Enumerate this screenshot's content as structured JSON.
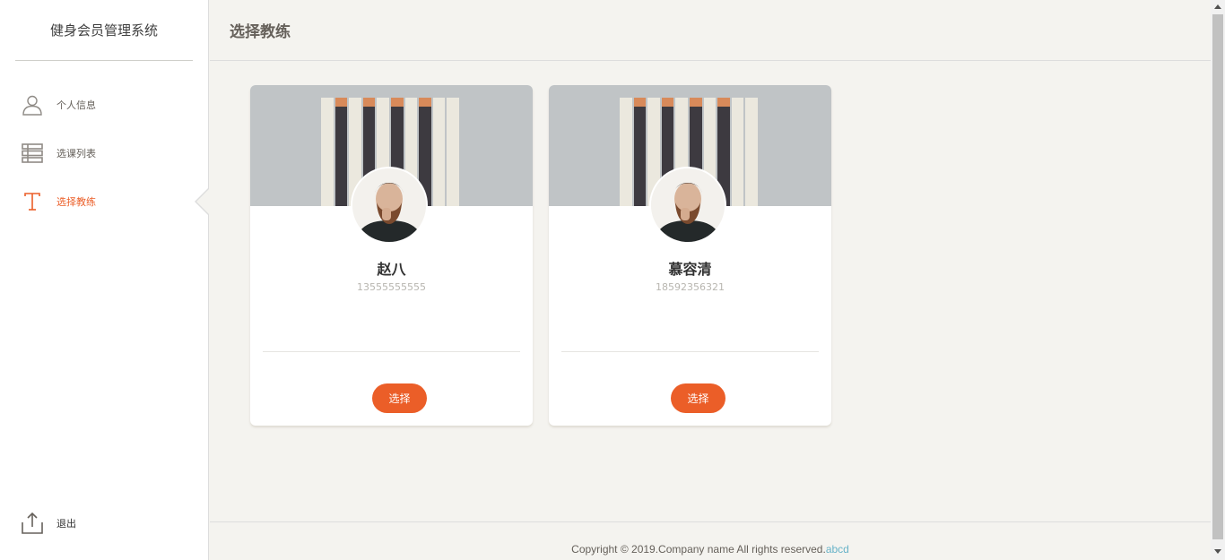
{
  "app": {
    "title": "健身会员管理系统"
  },
  "sidebar": {
    "items": [
      {
        "label": "个人信息",
        "icon": "user-icon",
        "active": false
      },
      {
        "label": "选课列表",
        "icon": "list-icon",
        "active": false
      },
      {
        "label": "选择教练",
        "icon": "text-t-icon",
        "active": true
      }
    ],
    "logout": {
      "label": "退出",
      "icon": "upload-icon"
    }
  },
  "header": {
    "title": "选择教练"
  },
  "coaches": [
    {
      "name": "赵八",
      "phone": "13555555555",
      "button_label": "选择"
    },
    {
      "name": "慕容清",
      "phone": "18592356321",
      "button_label": "选择"
    }
  ],
  "footer": {
    "text": "Copyright © 2019.Company name All rights reserved.",
    "link": "abcd"
  },
  "colors": {
    "accent": "#eb5e28",
    "background": "#f4f3ef",
    "link": "#68b3c8"
  }
}
